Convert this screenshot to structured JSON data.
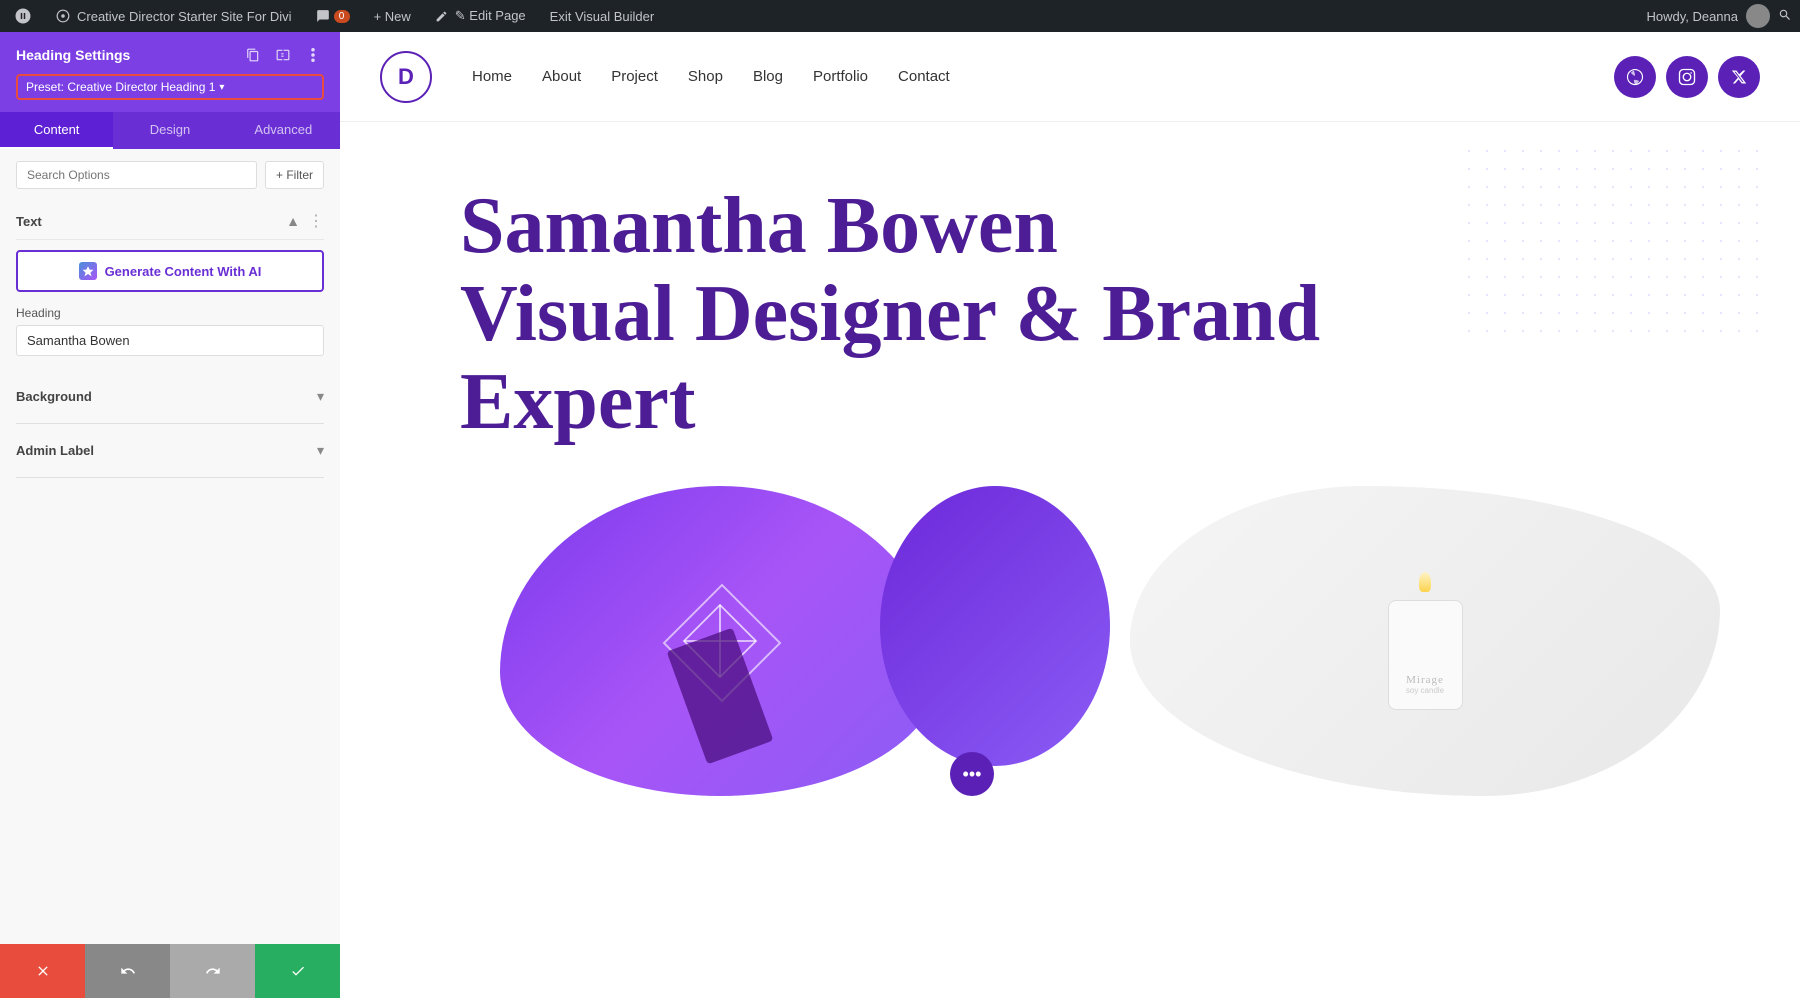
{
  "admin_bar": {
    "wp_label": "⚲",
    "site_name": "Creative Director Starter Site For Divi",
    "comment_icon": "💬",
    "comment_count": "0",
    "new_label": "+ New",
    "edit_page_label": "✎ Edit Page",
    "exit_builder_label": "Exit Visual Builder",
    "howdy_label": "Howdy, Deanna",
    "search_icon": "🔍"
  },
  "panel": {
    "title": "Heading Settings",
    "preset_label": "Preset: Creative Director Heading 1",
    "icons": {
      "copy": "⧉",
      "columns": "⊞",
      "more": "⋮"
    },
    "tabs": [
      {
        "id": "content",
        "label": "Content",
        "active": true
      },
      {
        "id": "design",
        "label": "Design",
        "active": false
      },
      {
        "id": "advanced",
        "label": "Advanced",
        "active": false
      }
    ],
    "search_placeholder": "Search Options",
    "filter_label": "+ Filter",
    "sections": {
      "text": {
        "label": "Text",
        "ai_button_label": "Generate Content With AI",
        "ai_icon_label": "AI",
        "heading_field_label": "Heading",
        "heading_value": "Samantha Bowen"
      },
      "background": {
        "label": "Background"
      },
      "admin_label": {
        "label": "Admin Label"
      }
    },
    "bottom": {
      "cancel_icon": "✕",
      "undo_icon": "↩",
      "redo_icon": "↪",
      "save_icon": "✓"
    }
  },
  "site": {
    "logo_letter": "D",
    "nav_links": [
      "Home",
      "About",
      "Project",
      "Shop",
      "Blog",
      "Portfolio",
      "Contact"
    ],
    "social": [
      {
        "icon": "✿",
        "name": "dribbble"
      },
      {
        "icon": "📷",
        "name": "instagram"
      },
      {
        "icon": "✕",
        "name": "twitter-x"
      }
    ],
    "hero": {
      "line1": "Samantha Bowen",
      "line2": "Visual Designer & Brand",
      "line3": "Expert"
    },
    "more_button_icon": "•••"
  }
}
